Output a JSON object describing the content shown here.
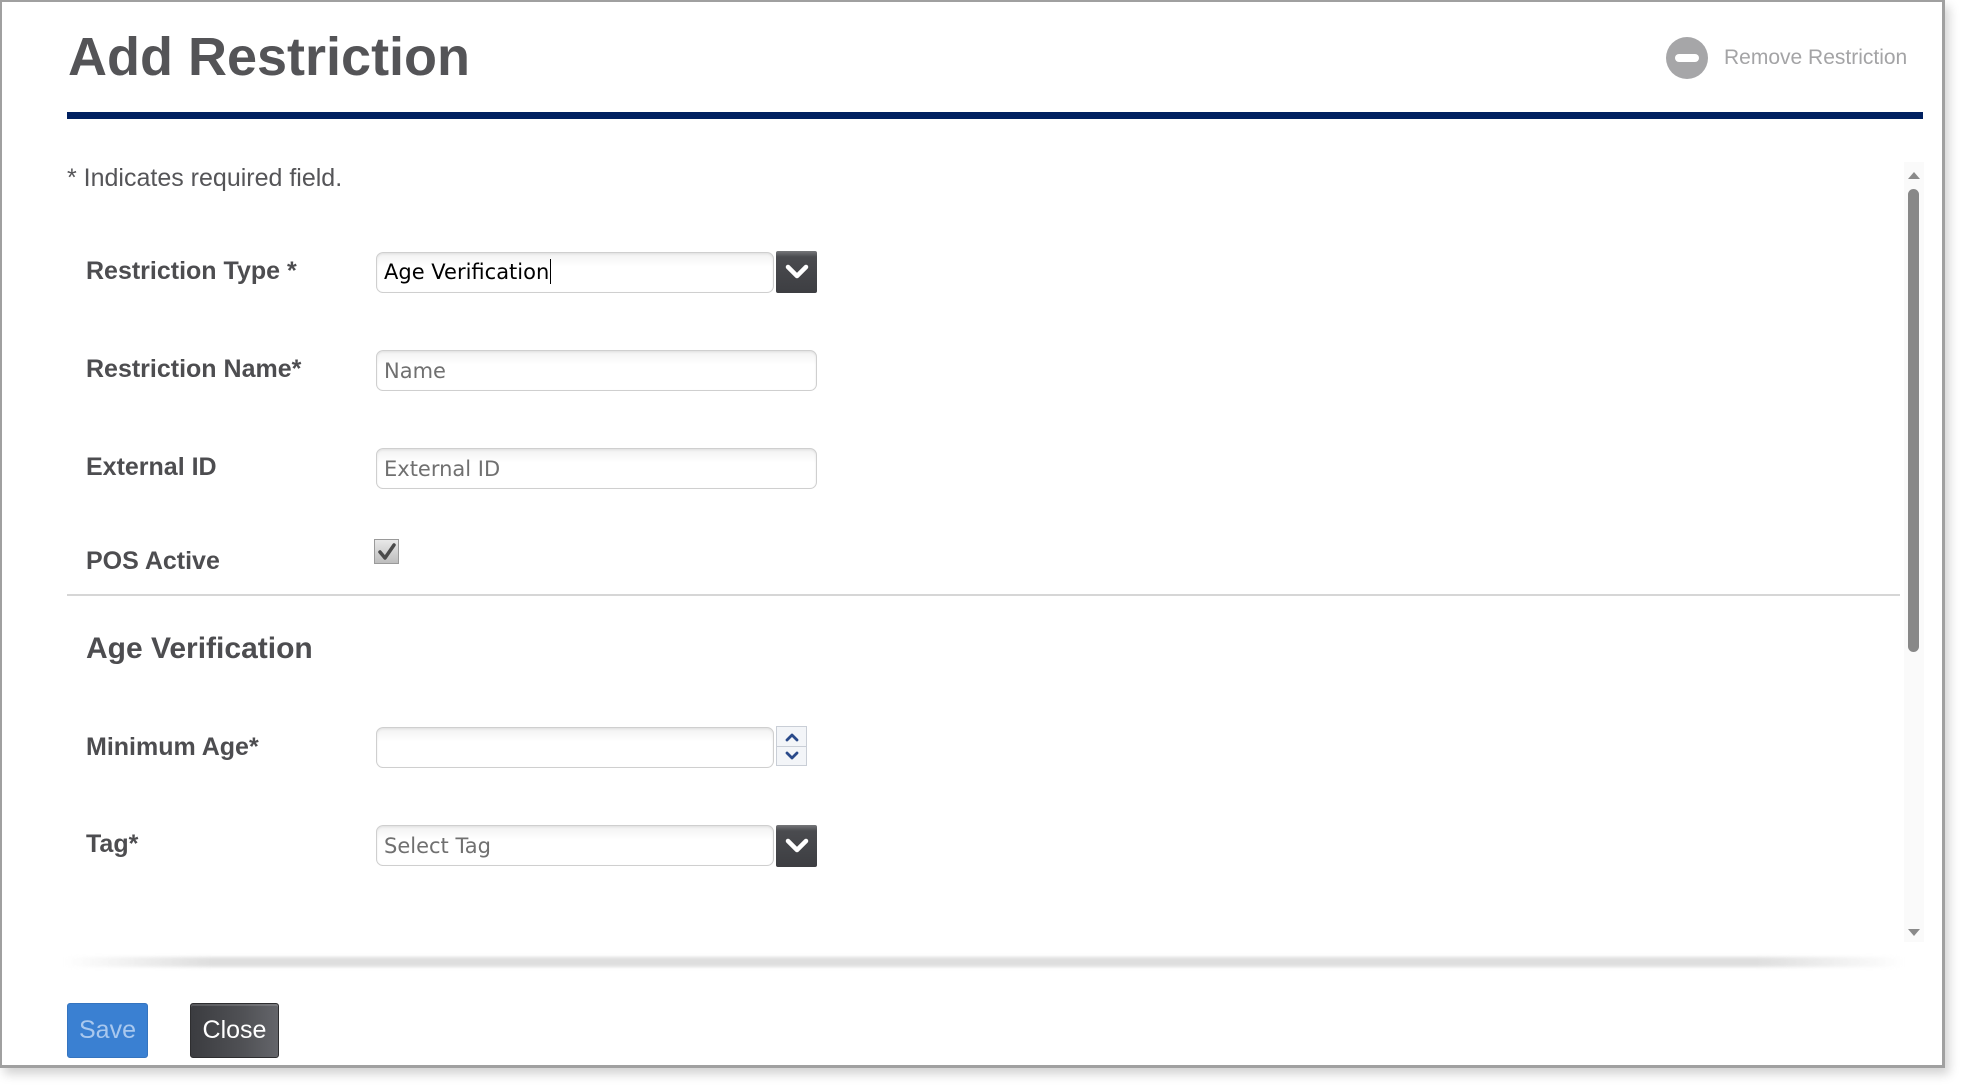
{
  "dialog": {
    "title": "Add Restriction",
    "remove_action": {
      "label": "Remove Restriction",
      "icon": "minus-circle-icon"
    },
    "accent_color": "#002060",
    "required_note": "* Indicates required field."
  },
  "form": {
    "restriction_type": {
      "label": "Restriction Type *",
      "value": "Age Verification",
      "icon": "chevron-down-icon"
    },
    "restriction_name": {
      "label": "Restriction Name*",
      "value": "",
      "placeholder": "Name"
    },
    "external_id": {
      "label": "External ID",
      "value": "",
      "placeholder": "External ID"
    },
    "pos_active": {
      "label": "POS Active",
      "checked": true
    }
  },
  "age_verification": {
    "section_title": "Age Verification",
    "minimum_age": {
      "label": "Minimum Age*",
      "value": "",
      "icons": [
        "chevron-up-icon",
        "chevron-down-icon"
      ]
    },
    "tag": {
      "label": "Tag*",
      "placeholder": "Select Tag",
      "icon": "chevron-down-icon"
    }
  },
  "footer": {
    "save_label": "Save",
    "close_label": "Close",
    "save_color": "#3a80d2",
    "close_color": "#45464a"
  }
}
